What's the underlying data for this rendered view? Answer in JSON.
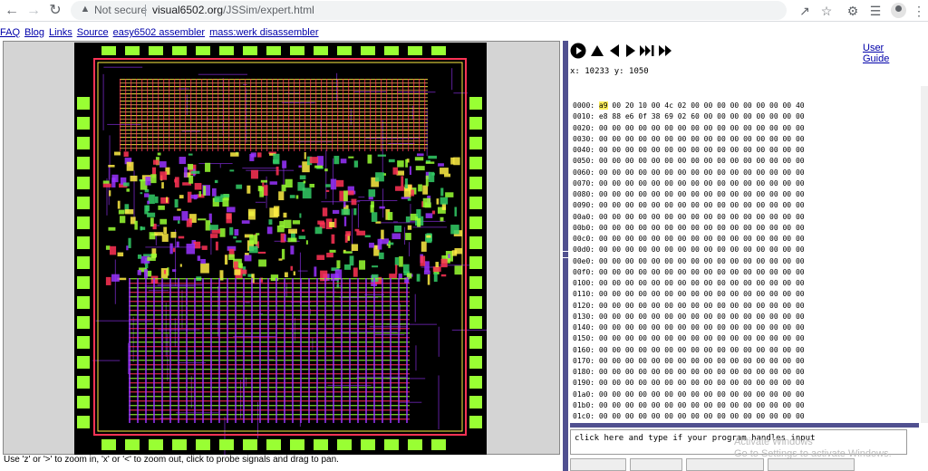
{
  "browser": {
    "back_icon": "arrow-left-icon",
    "forward_icon": "arrow-right-icon",
    "reload_icon": "reload-icon",
    "security_label": "Not secure",
    "url_host": "visual6502.org",
    "url_path": "/JSSim/expert.html"
  },
  "links": [
    "FAQ",
    "Blog",
    "Links",
    "Source",
    "easy6502 assembler",
    "mass:werk disassembler"
  ],
  "help_text": "Use 'z' or '>' to zoom in, 'x' or '<' to zoom out, click to probe signals and drag to pan.",
  "controls": {
    "icons": [
      "play-icon",
      "step-up-icon",
      "step-back-icon",
      "step-forward-icon",
      "fast-forward-end-icon",
      "fast-forward-icon"
    ],
    "user_guide": "User Guide",
    "coords": "x: 10233 y: 1050"
  },
  "memory": [
    {
      "addr": "0000:",
      "bytes": [
        "a9",
        "00",
        "20",
        "10",
        "00",
        "4c",
        "02",
        "00",
        "00",
        "00",
        "00",
        "00",
        "00",
        "00",
        "00",
        "40"
      ]
    },
    {
      "addr": "0010:",
      "bytes": [
        "e8",
        "88",
        "e6",
        "0f",
        "38",
        "69",
        "02",
        "60",
        "00",
        "00",
        "00",
        "00",
        "00",
        "00",
        "00",
        "00"
      ]
    },
    {
      "addr": "0020:",
      "bytes": [
        "00",
        "00",
        "00",
        "00",
        "00",
        "00",
        "00",
        "00",
        "00",
        "00",
        "00",
        "00",
        "00",
        "00",
        "00",
        "00"
      ]
    },
    {
      "addr": "0030:",
      "bytes": [
        "00",
        "00",
        "00",
        "00",
        "00",
        "00",
        "00",
        "00",
        "00",
        "00",
        "00",
        "00",
        "00",
        "00",
        "00",
        "00"
      ]
    },
    {
      "addr": "0040:",
      "bytes": [
        "00",
        "00",
        "00",
        "00",
        "00",
        "00",
        "00",
        "00",
        "00",
        "00",
        "00",
        "00",
        "00",
        "00",
        "00",
        "00"
      ]
    },
    {
      "addr": "0050:",
      "bytes": [
        "00",
        "00",
        "00",
        "00",
        "00",
        "00",
        "00",
        "00",
        "00",
        "00",
        "00",
        "00",
        "00",
        "00",
        "00",
        "00"
      ]
    },
    {
      "addr": "0060:",
      "bytes": [
        "00",
        "00",
        "00",
        "00",
        "00",
        "00",
        "00",
        "00",
        "00",
        "00",
        "00",
        "00",
        "00",
        "00",
        "00",
        "00"
      ]
    },
    {
      "addr": "0070:",
      "bytes": [
        "00",
        "00",
        "00",
        "00",
        "00",
        "00",
        "00",
        "00",
        "00",
        "00",
        "00",
        "00",
        "00",
        "00",
        "00",
        "00"
      ]
    },
    {
      "addr": "0080:",
      "bytes": [
        "00",
        "00",
        "00",
        "00",
        "00",
        "00",
        "00",
        "00",
        "00",
        "00",
        "00",
        "00",
        "00",
        "00",
        "00",
        "00"
      ]
    },
    {
      "addr": "0090:",
      "bytes": [
        "00",
        "00",
        "00",
        "00",
        "00",
        "00",
        "00",
        "00",
        "00",
        "00",
        "00",
        "00",
        "00",
        "00",
        "00",
        "00"
      ]
    },
    {
      "addr": "00a0:",
      "bytes": [
        "00",
        "00",
        "00",
        "00",
        "00",
        "00",
        "00",
        "00",
        "00",
        "00",
        "00",
        "00",
        "00",
        "00",
        "00",
        "00"
      ]
    },
    {
      "addr": "00b0:",
      "bytes": [
        "00",
        "00",
        "00",
        "00",
        "00",
        "00",
        "00",
        "00",
        "00",
        "00",
        "00",
        "00",
        "00",
        "00",
        "00",
        "00"
      ]
    },
    {
      "addr": "00c0:",
      "bytes": [
        "00",
        "00",
        "00",
        "00",
        "00",
        "00",
        "00",
        "00",
        "00",
        "00",
        "00",
        "00",
        "00",
        "00",
        "00",
        "00"
      ]
    },
    {
      "addr": "00d0:",
      "bytes": [
        "00",
        "00",
        "00",
        "00",
        "00",
        "00",
        "00",
        "00",
        "00",
        "00",
        "00",
        "00",
        "00",
        "00",
        "00",
        "00"
      ]
    },
    {
      "addr": "00e0:",
      "bytes": [
        "00",
        "00",
        "00",
        "00",
        "00",
        "00",
        "00",
        "00",
        "00",
        "00",
        "00",
        "00",
        "00",
        "00",
        "00",
        "00"
      ]
    },
    {
      "addr": "00f0:",
      "bytes": [
        "00",
        "00",
        "00",
        "00",
        "00",
        "00",
        "00",
        "00",
        "00",
        "00",
        "00",
        "00",
        "00",
        "00",
        "00",
        "00"
      ]
    },
    {
      "addr": "0100:",
      "bytes": [
        "00",
        "00",
        "00",
        "00",
        "00",
        "00",
        "00",
        "00",
        "00",
        "00",
        "00",
        "00",
        "00",
        "00",
        "00",
        "00"
      ]
    },
    {
      "addr": "0110:",
      "bytes": [
        "00",
        "00",
        "00",
        "00",
        "00",
        "00",
        "00",
        "00",
        "00",
        "00",
        "00",
        "00",
        "00",
        "00",
        "00",
        "00"
      ]
    },
    {
      "addr": "0120:",
      "bytes": [
        "00",
        "00",
        "00",
        "00",
        "00",
        "00",
        "00",
        "00",
        "00",
        "00",
        "00",
        "00",
        "00",
        "00",
        "00",
        "00"
      ]
    },
    {
      "addr": "0130:",
      "bytes": [
        "00",
        "00",
        "00",
        "00",
        "00",
        "00",
        "00",
        "00",
        "00",
        "00",
        "00",
        "00",
        "00",
        "00",
        "00",
        "00"
      ]
    },
    {
      "addr": "0140:",
      "bytes": [
        "00",
        "00",
        "00",
        "00",
        "00",
        "00",
        "00",
        "00",
        "00",
        "00",
        "00",
        "00",
        "00",
        "00",
        "00",
        "00"
      ]
    },
    {
      "addr": "0150:",
      "bytes": [
        "00",
        "00",
        "00",
        "00",
        "00",
        "00",
        "00",
        "00",
        "00",
        "00",
        "00",
        "00",
        "00",
        "00",
        "00",
        "00"
      ]
    },
    {
      "addr": "0160:",
      "bytes": [
        "00",
        "00",
        "00",
        "00",
        "00",
        "00",
        "00",
        "00",
        "00",
        "00",
        "00",
        "00",
        "00",
        "00",
        "00",
        "00"
      ]
    },
    {
      "addr": "0170:",
      "bytes": [
        "00",
        "00",
        "00",
        "00",
        "00",
        "00",
        "00",
        "00",
        "00",
        "00",
        "00",
        "00",
        "00",
        "00",
        "00",
        "00"
      ]
    },
    {
      "addr": "0180:",
      "bytes": [
        "00",
        "00",
        "00",
        "00",
        "00",
        "00",
        "00",
        "00",
        "00",
        "00",
        "00",
        "00",
        "00",
        "00",
        "00",
        "00"
      ]
    },
    {
      "addr": "0190:",
      "bytes": [
        "00",
        "00",
        "00",
        "00",
        "00",
        "00",
        "00",
        "00",
        "00",
        "00",
        "00",
        "00",
        "00",
        "00",
        "00",
        "00"
      ]
    },
    {
      "addr": "01a0:",
      "bytes": [
        "00",
        "00",
        "00",
        "00",
        "00",
        "00",
        "00",
        "00",
        "00",
        "00",
        "00",
        "00",
        "00",
        "00",
        "00",
        "00"
      ]
    },
    {
      "addr": "01b0:",
      "bytes": [
        "00",
        "00",
        "00",
        "00",
        "00",
        "00",
        "00",
        "00",
        "00",
        "00",
        "00",
        "00",
        "00",
        "00",
        "00",
        "00"
      ]
    },
    {
      "addr": "01c0:",
      "bytes": [
        "00",
        "00",
        "00",
        "00",
        "00",
        "00",
        "00",
        "00",
        "00",
        "00",
        "00",
        "00",
        "00",
        "00",
        "00",
        "00"
      ]
    }
  ],
  "highlight_byte": "a9",
  "console_text": "click here and type if your program handles input",
  "activation": {
    "line1": "Activate Windows",
    "line2": "Go to Settings to activate Windows."
  },
  "colors": {
    "chip_bg": "#000000",
    "metal_red": "#ff3355",
    "poly_green": "#99ff33",
    "diff_yellow": "#ffee44",
    "metal_purple": "#9933ff",
    "accent_blue": "#505090",
    "link": "#0000aa"
  }
}
